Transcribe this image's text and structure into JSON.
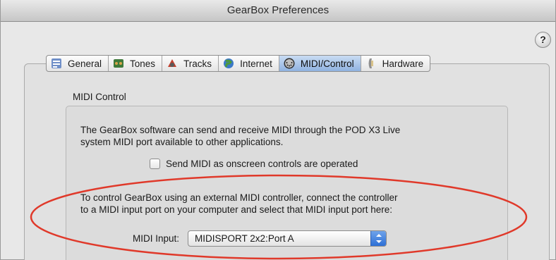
{
  "window": {
    "title": "GearBox Preferences"
  },
  "help": {
    "label": "?"
  },
  "tabs": [
    {
      "label": "General",
      "icon": "general-icon",
      "selected": false
    },
    {
      "label": "Tones",
      "icon": "tones-icon",
      "selected": false
    },
    {
      "label": "Tracks",
      "icon": "tracks-icon",
      "selected": false
    },
    {
      "label": "Internet",
      "icon": "internet-icon",
      "selected": false
    },
    {
      "label": "MIDI/Control",
      "icon": "midi-connector-icon",
      "selected": true
    },
    {
      "label": "Hardware",
      "icon": "hardware-icon",
      "selected": false
    }
  ],
  "midi_control": {
    "group_label": "MIDI Control",
    "description_1_line_1": "The GearBox software can send and receive MIDI through the POD X3 Live",
    "description_1_line_2": "system MIDI port available to other applications.",
    "send_midi_checkbox": {
      "label": "Send MIDI as onscreen controls are operated",
      "checked": false
    },
    "description_2_line_1": "To control GearBox using an external MIDI controller, connect the controller",
    "description_2_line_2": "to a MIDI input port on your computer and select that MIDI input port here:",
    "midi_input": {
      "label": "MIDI Input:",
      "value": "MIDISPORT 2x2:Port A"
    }
  },
  "colors": {
    "annotation": "#e0392a",
    "selected_tab": "#8fb2e0",
    "popup_arrows": "#2d6fd6"
  }
}
